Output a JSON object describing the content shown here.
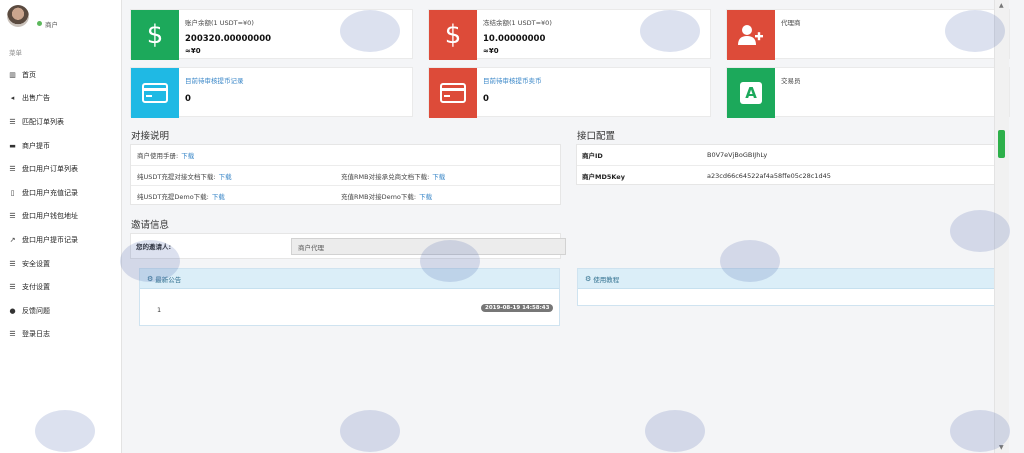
{
  "sidebar": {
    "user_role": "商户",
    "menu_head": "菜单",
    "items": [
      {
        "icon": "bar-chart-icon",
        "glyph": "▥",
        "label": "首页"
      },
      {
        "icon": "bullhorn-icon",
        "glyph": "◂",
        "label": "出售广告"
      },
      {
        "icon": "list-icon",
        "glyph": "☰",
        "label": "匹配订单列表"
      },
      {
        "icon": "credit-card-icon",
        "glyph": "▬",
        "label": "商户提币"
      },
      {
        "icon": "list-icon",
        "glyph": "☰",
        "label": "盘口用户订单列表"
      },
      {
        "icon": "file-icon",
        "glyph": "▯",
        "label": "盘口用户充值记录"
      },
      {
        "icon": "list-icon",
        "glyph": "☰",
        "label": "盘口用户钱包地址"
      },
      {
        "icon": "external-link-icon",
        "glyph": "↗",
        "label": "盘口用户提币记录"
      },
      {
        "icon": "list-icon",
        "glyph": "☰",
        "label": "安全设置"
      },
      {
        "icon": "list-icon",
        "glyph": "☰",
        "label": "支付设置"
      },
      {
        "icon": "comment-icon",
        "glyph": "●",
        "label": "反馈问题"
      },
      {
        "icon": "list-icon",
        "glyph": "☰",
        "label": "登录日志"
      }
    ]
  },
  "cards": {
    "account_balance": {
      "title": "账户余额(1 USDT=¥0)",
      "value": "200320.00000000",
      "sub": "≈¥0",
      "icon": "dollar-icon",
      "glyph": "$"
    },
    "frozen_balance": {
      "title": "冻结余额(1 USDT=¥0)",
      "value": "10.00000000",
      "sub": "≈¥0",
      "icon": "dollar-icon",
      "glyph": "$"
    },
    "agent": {
      "title": "代理商",
      "icon": "user-plus-icon"
    },
    "pending_withdraw": {
      "title": "目前待审核提币记录",
      "value": "0",
      "icon": "credit-card-icon"
    },
    "pending_sell": {
      "title": "目前待审核提币卖币",
      "value": "0",
      "icon": "credit-card-icon"
    },
    "trader": {
      "title": "交易员",
      "icon": "a-icon",
      "glyph": "A"
    }
  },
  "integration": {
    "title": "对接说明",
    "manual_label": "商户使用手册:",
    "download": "下载",
    "usdt_doc_label": "纯USDT充提对接文档下载:",
    "rmb_doc_label": "充值RMB对接承兑商文档下载:",
    "usdt_demo_label": "纯USDT充提Demo下载:",
    "rmb_demo_label": "充值RMB对接Demo下载:"
  },
  "api": {
    "title": "接口配置",
    "merchant_id_label": "商户ID",
    "merchant_id": "B0V7eVjBoGBIJhLy",
    "md5_label": "商户MD5Key",
    "md5": "a23cd66c64522af4a58ffe05c28c1d45"
  },
  "invite": {
    "title": "邀请信息",
    "inviter_label": "您的邀请人:",
    "inviter_value": "商户代理"
  },
  "notice": {
    "title": "最新公告",
    "items": [
      {
        "index": "1",
        "time": "2019-08-19 14:58:43"
      }
    ]
  },
  "tutorial": {
    "title": "使用教程"
  },
  "colors": {
    "green": "#1ca95b",
    "red": "#dd4b39",
    "cyan": "#1fb9e4",
    "link": "#3a87c8"
  }
}
